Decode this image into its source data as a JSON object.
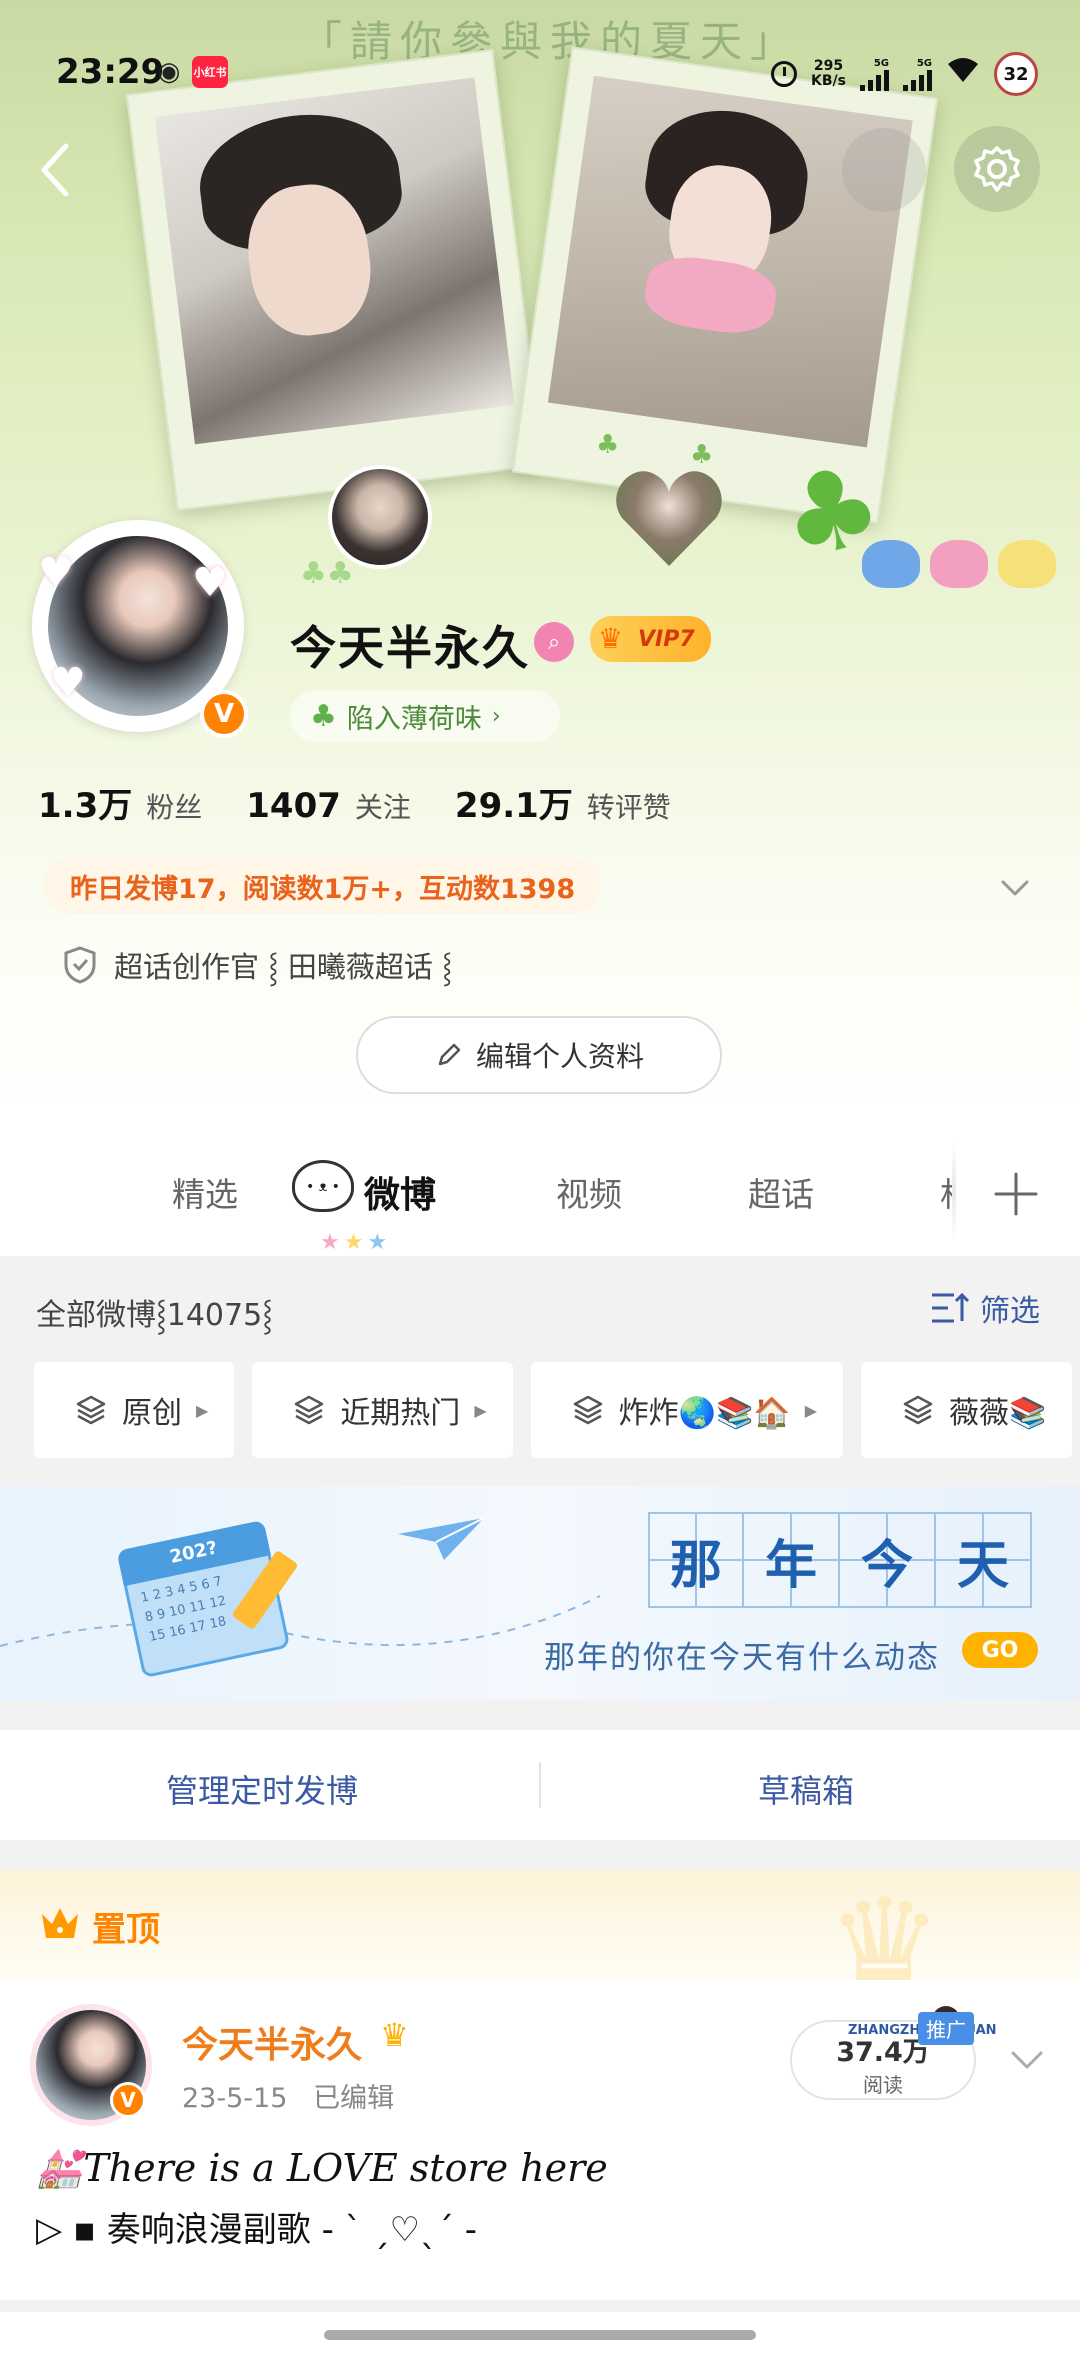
{
  "status_bar": {
    "time": "23:29",
    "app_badge": "小红书",
    "net_speed_value": "295",
    "net_speed_unit": "KB/s",
    "sim1": "5G",
    "sim2": "5G",
    "battery": "32"
  },
  "header": {
    "banner_text": "「請你參與我的夏天」"
  },
  "profile": {
    "name": "今天半永久",
    "vip_label": "VIP7",
    "verified_badge": "V",
    "mint_label": "陷入薄荷味",
    "stats": [
      {
        "value": "1.3万",
        "label": "粉丝"
      },
      {
        "value": "1407",
        "label": "关注"
      },
      {
        "value": "29.1万",
        "label": "转评赞"
      }
    ],
    "activity": "昨日发博17，阅读数1万+，互动数1398",
    "super_topic": "超话创作官 ⸾ 田曦薇超话 ⸾",
    "edit_label": "编辑个人资料"
  },
  "tabs": {
    "items": [
      "精选",
      "微博",
      "视频",
      "超话",
      "相"
    ],
    "active": "微博"
  },
  "feed": {
    "all_posts": "全部微博⸾14075⸾",
    "filter_label": "筛选",
    "chips": [
      "原创",
      "近期热门",
      "炸炸🌏📚🏠",
      "薇薇📚"
    ]
  },
  "throwback": {
    "chars": [
      "那",
      "年",
      "今",
      "天"
    ],
    "subtitle": "那年的你在今天有什么动态",
    "go_label": "GO",
    "calendar_year": "202?"
  },
  "manage": {
    "scheduled": "管理定时发博",
    "drafts": "草稿箱"
  },
  "pinned": {
    "label": "置顶"
  },
  "post": {
    "author": "今天半永久",
    "date": "23-5-15",
    "edited": "已编辑",
    "reads_value": "37.4万",
    "reads_label": "阅读",
    "promo_label": "推广",
    "promo_text_left": "ZHANGZHE",
    "promo_text_right": "YUAN",
    "line1": "💒There is a LOVE store here",
    "line2": "▷ ▪ 奏响浪漫副歌 - ˋ ˏ♡ˎˊ -"
  },
  "colors": {
    "accent_orange": "#ff8200",
    "link_blue": "#3b5aa3",
    "name_orange": "#f07d1c",
    "mint_green": "#4d8a3a"
  }
}
